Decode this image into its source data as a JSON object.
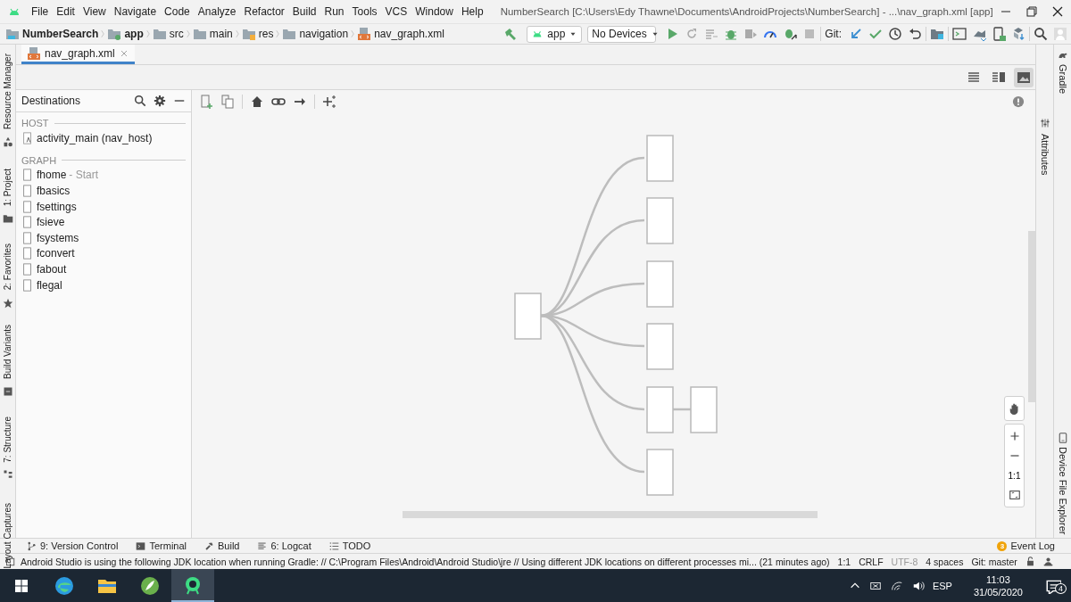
{
  "menu_bar": {
    "items": [
      "File",
      "Edit",
      "View",
      "Navigate",
      "Code",
      "Analyze",
      "Refactor",
      "Build",
      "Run",
      "Tools",
      "VCS",
      "Window",
      "Help"
    ],
    "title": "NumberSearch [C:\\Users\\Edy Thawne\\Documents\\AndroidProjects\\NumberSearch] - ...\\nav_graph.xml [app]"
  },
  "breadcrumbs": [
    {
      "label": "NumberSearch",
      "kind": "project"
    },
    {
      "label": "app",
      "kind": "module"
    },
    {
      "label": "src",
      "kind": "folder"
    },
    {
      "label": "main",
      "kind": "folder"
    },
    {
      "label": "res",
      "kind": "resources"
    },
    {
      "label": "navigation",
      "kind": "folder"
    },
    {
      "label": "nav_graph.xml",
      "kind": "file"
    }
  ],
  "run_toolbar": {
    "configuration": "app",
    "device": "No Devices",
    "git_label": "Git:"
  },
  "editor_tabs": [
    {
      "label": "nav_graph.xml",
      "selected": true
    }
  ],
  "view_modes": [
    {
      "kind": "code",
      "selected": false
    },
    {
      "kind": "split",
      "selected": false
    },
    {
      "kind": "design",
      "selected": true
    }
  ],
  "destinations": {
    "title": "Destinations",
    "sections": [
      {
        "heading": "HOST",
        "items": [
          {
            "label": "activity_main (nav_host)",
            "kind": "host"
          }
        ]
      },
      {
        "heading": "GRAPH",
        "items": [
          {
            "label": "fhome",
            "note": "- Start",
            "kind": "fragment"
          },
          {
            "label": "fbasics",
            "kind": "fragment"
          },
          {
            "label": "fsettings",
            "kind": "fragment"
          },
          {
            "label": "fsieve",
            "kind": "fragment"
          },
          {
            "label": "fsystems",
            "kind": "fragment"
          },
          {
            "label": "fconvert",
            "kind": "fragment"
          },
          {
            "label": "fabout",
            "kind": "fragment"
          },
          {
            "label": "flegal",
            "kind": "fragment"
          }
        ]
      }
    ]
  },
  "zoom_controls": {
    "actual_size": "1:1"
  },
  "left_tool_windows": [
    {
      "label": "Resource Manager",
      "kind": "resources"
    },
    {
      "label": "1: Project",
      "kind": "project"
    },
    {
      "label": "2: Favorites",
      "kind": "favorites"
    },
    {
      "label": "Build Variants",
      "kind": "variants"
    },
    {
      "label": "7: Structure",
      "kind": "structure"
    },
    {
      "label": "Layout Captures",
      "kind": "captures"
    }
  ],
  "attributes_tab": "Attributes",
  "right_tool_windows": [
    {
      "label": "Gradle",
      "kind": "gradle"
    },
    {
      "label": "Device File Explorer",
      "kind": "device"
    }
  ],
  "bottom_tool_windows": [
    {
      "label": "9: Version Control",
      "kind": "vcs"
    },
    {
      "label": "Terminal",
      "kind": "terminal"
    },
    {
      "label": "Build",
      "kind": "build"
    },
    {
      "label": "6: Logcat",
      "kind": "logcat"
    },
    {
      "label": "TODO",
      "kind": "todo"
    }
  ],
  "event_log": {
    "label": "Event Log",
    "count": "3"
  },
  "status_bar": {
    "message": "Android Studio is using the following JDK location when running Gradle: // C:\\Program Files\\Android\\Android Studio\\jre // Using different JDK locations on different processes mi... (21 minutes ago)",
    "position": "1:1",
    "line_separator": "CRLF",
    "encoding": "UTF-8",
    "indent": "4 spaces",
    "branch": "Git: master"
  },
  "taskbar": {
    "language": "ESP",
    "time": "11:03",
    "date": "31/05/2020",
    "notifications": "4"
  }
}
